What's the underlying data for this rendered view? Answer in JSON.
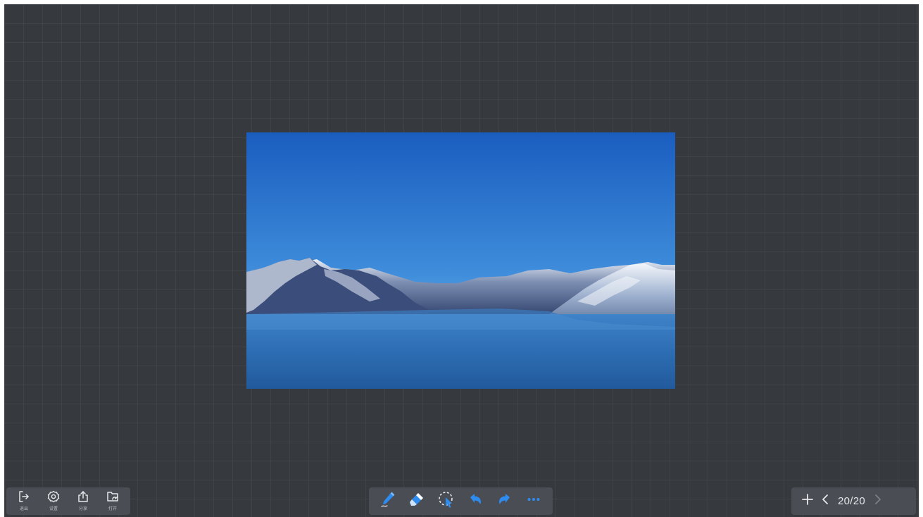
{
  "canvas": {
    "background": "#36393e",
    "image": {
      "subject": "mountain-lake-photo"
    }
  },
  "system_toolbar": {
    "items": [
      {
        "id": "exit",
        "label": "退出",
        "icon": "exit-icon"
      },
      {
        "id": "settings",
        "label": "设置",
        "icon": "gear-icon"
      },
      {
        "id": "share",
        "label": "分享",
        "icon": "share-icon"
      },
      {
        "id": "open",
        "label": "打开",
        "icon": "folder-icon"
      }
    ]
  },
  "tools_toolbar": {
    "accent": "#2e8cf0",
    "items": [
      {
        "id": "pen",
        "icon": "pen-icon",
        "active": true
      },
      {
        "id": "eraser",
        "icon": "eraser-icon"
      },
      {
        "id": "select",
        "icon": "lasso-select-icon"
      },
      {
        "id": "undo",
        "icon": "undo-icon"
      },
      {
        "id": "redo",
        "icon": "redo-icon"
      },
      {
        "id": "more",
        "icon": "more-icon"
      }
    ]
  },
  "page_nav": {
    "indicator": "20/20",
    "current": 20,
    "total": 20
  }
}
